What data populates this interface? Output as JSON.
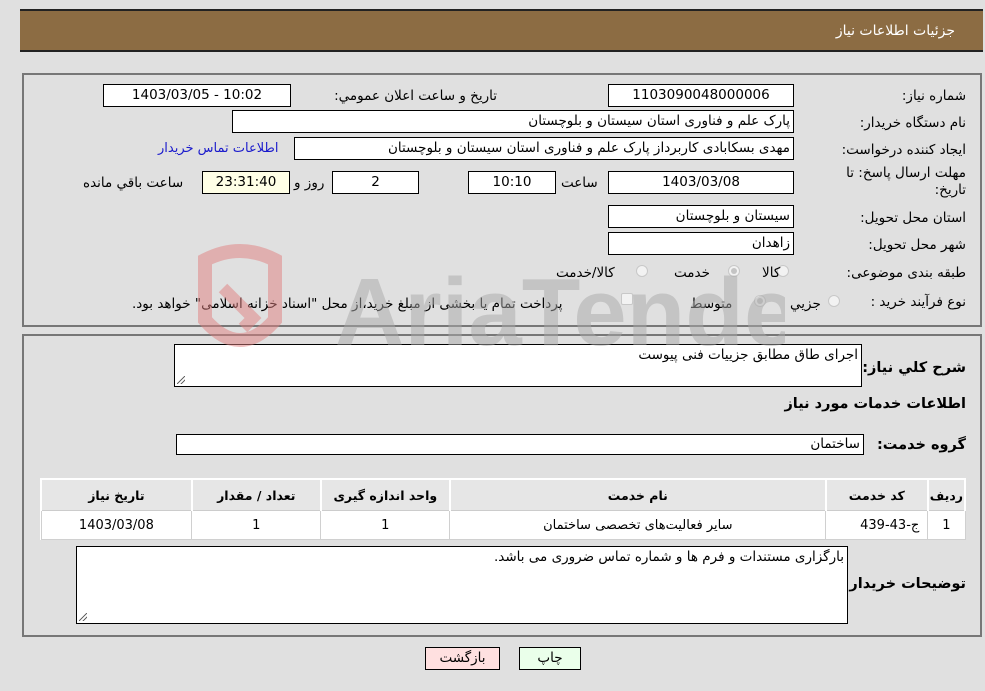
{
  "header": {
    "title": "جزئیات اطلاعات نیاز"
  },
  "form": {
    "need_number": {
      "label": "شماره نیاز:",
      "value": "1103090048000006"
    },
    "announce_datetime": {
      "label": "تاريخ و ساعت اعلان عمومي:",
      "value": "1403/03/05 - 10:02"
    },
    "buyer_org": {
      "label": "نام دستگاه خریدار:",
      "value": "پارک علم و فناوری استان سیستان و بلوچستان"
    },
    "requester": {
      "label": "ایجاد کننده درخواست:",
      "value": "مهدی بسکابادی کاربرداز پارک علم و فناوری استان سیستان و بلوچستان"
    },
    "buyer_contact_link": "اطلاعات تماس خریدار",
    "deadline": {
      "label_line1": "مهلت ارسال پاسخ: تا",
      "label_line2": "تاریخ:",
      "date": "1403/03/08",
      "time_label": "ساعت",
      "time": "10:10",
      "days": "2",
      "days_label": "روز و",
      "remaining": "23:31:40",
      "remaining_label": "ساعت باقي مانده"
    },
    "delivery_province": {
      "label": "استان محل تحویل:",
      "value": "سیستان و بلوچستان"
    },
    "delivery_city": {
      "label": "شهر محل تحویل:",
      "value": "زاهدان"
    },
    "category": {
      "label": "طبقه بندی موضوعی:",
      "options": [
        "کالا",
        "خدمت",
        "کالا/خدمت"
      ],
      "selected": "خدمت"
    },
    "purchase_type": {
      "label": "نوع فرآیند خرید :",
      "options": [
        "جزيي",
        "متوسط"
      ],
      "selected": "متوسط",
      "treasury_note": "پرداخت تمام یا بخشی از مبلغ خرید،از محل \"اسناد خزانه اسلامی\" خواهد بود.",
      "treasury_checked": false
    }
  },
  "details": {
    "description_label": "شرح کلي نیاز:",
    "description": "اجرای طاق مطابق جزییات فنی پیوست",
    "services_title": "اطلاعات خدمات مورد نیاز",
    "service_group_label": "گروه خدمت:",
    "service_group": "ساختمان",
    "table": {
      "headers": [
        "ردیف",
        "کد خدمت",
        "نام خدمت",
        "واحد اندازه گیری",
        "تعداد / مقدار",
        "تاریخ نیاز"
      ],
      "rows": [
        [
          "1",
          "ج-43-439",
          "سایر فعالیت‌های تخصصی ساختمان",
          "1",
          "1",
          "1403/03/08"
        ]
      ]
    },
    "buyer_notes_label": "توضیحات خریدار:",
    "buyer_notes": "بارگزاری مستندات و فرم ها و شماره تماس ضروری می باشد."
  },
  "buttons": {
    "print": "چاپ",
    "back": "بازگشت"
  },
  "watermark": "AriaTender.neT",
  "colors": {
    "header_bg": "#8c6c43",
    "print_bg": "#eaffea",
    "back_bg": "#ffe0e0",
    "link": "#1a1acc"
  }
}
